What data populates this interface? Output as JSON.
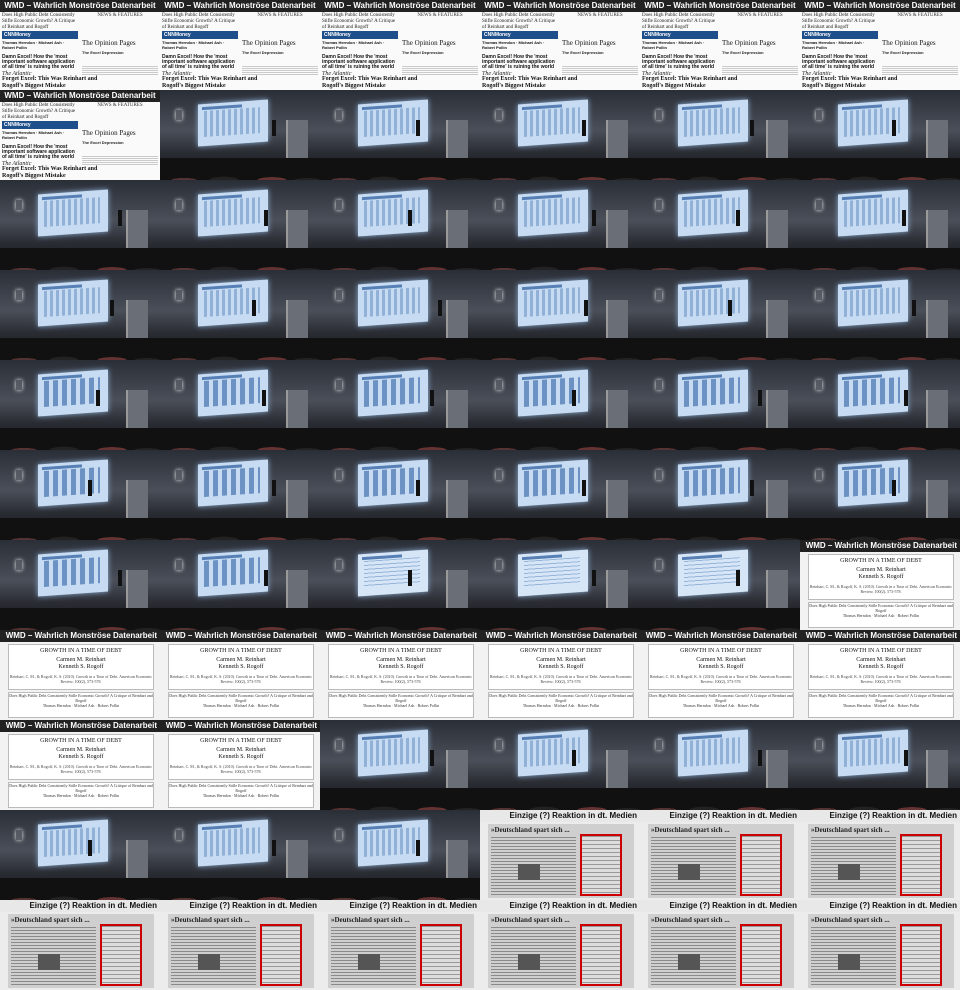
{
  "slides": {
    "clippings": {
      "title": "WMD – Wahrlich Monströse Datenarbeit",
      "left_top": "Does High Public Debt Consistently Stifle Economic Growth? A Critique of Reinhart and Rogoff",
      "cnn_label": "CNNMoney",
      "mid_text": "Thomas Herndon · Michael Ash · Robert Pollin",
      "headline": "Damn Excel! How the 'most important software application of all time' is ruining the world",
      "atlantic": "The Atlantic",
      "big_headline": "Forget Excel: This Was Reinhart and Rogoff's Biggest Mistake",
      "right_top": "NEWS & FEATURES",
      "opinion": "The Opinion Pages",
      "right_mid": "The Excel Depression"
    },
    "title_slide": {
      "bar": "WMD – Wahrlich Monströse Datenarbeit",
      "heading": "GROWTH IN A TIME OF DEBT",
      "authors": "Carmen M. Reinhart\nKenneth S. Rogoff",
      "citation": "Reinhart, C. M., & Rogoff, K. S. (2010). Growth in a Time of Debt. American Economic Review, 100(2), 573-578.",
      "critique": "Does High Public Debt Consistently Stifle Economic Growth? A Critique of Reinhart and Rogoff",
      "critique_authors": "Thomas Herndon · Michael Ash · Robert Pollin"
    },
    "news_slide": {
      "bar": "Einzige (?) Reaktion in dt. Medien",
      "headline": "»Deutschland spart sich ..."
    }
  },
  "layout": {
    "cols": 6,
    "cells": [
      "clip",
      "clip",
      "clip",
      "clip",
      "clip",
      "clip",
      "clip",
      "photo",
      "photo",
      "photo",
      "photo",
      "photo",
      "photo",
      "photo",
      "photo",
      "photo",
      "photo",
      "photo",
      "photo",
      "photo",
      "photo",
      "photo",
      "photo",
      "photo",
      "chart",
      "chart",
      "chart",
      "chart",
      "chart",
      "chart",
      "chart",
      "chart",
      "chart",
      "chart",
      "chart",
      "chart",
      "chart",
      "chart",
      "text",
      "text",
      "text",
      "title",
      "title",
      "title",
      "title",
      "title",
      "title",
      "title",
      "title",
      "title",
      "photo",
      "photo",
      "photo",
      "photo",
      "photo",
      "photo",
      "photo",
      "news",
      "news",
      "news",
      "news",
      "news",
      "news",
      "news",
      "news",
      "news"
    ]
  }
}
